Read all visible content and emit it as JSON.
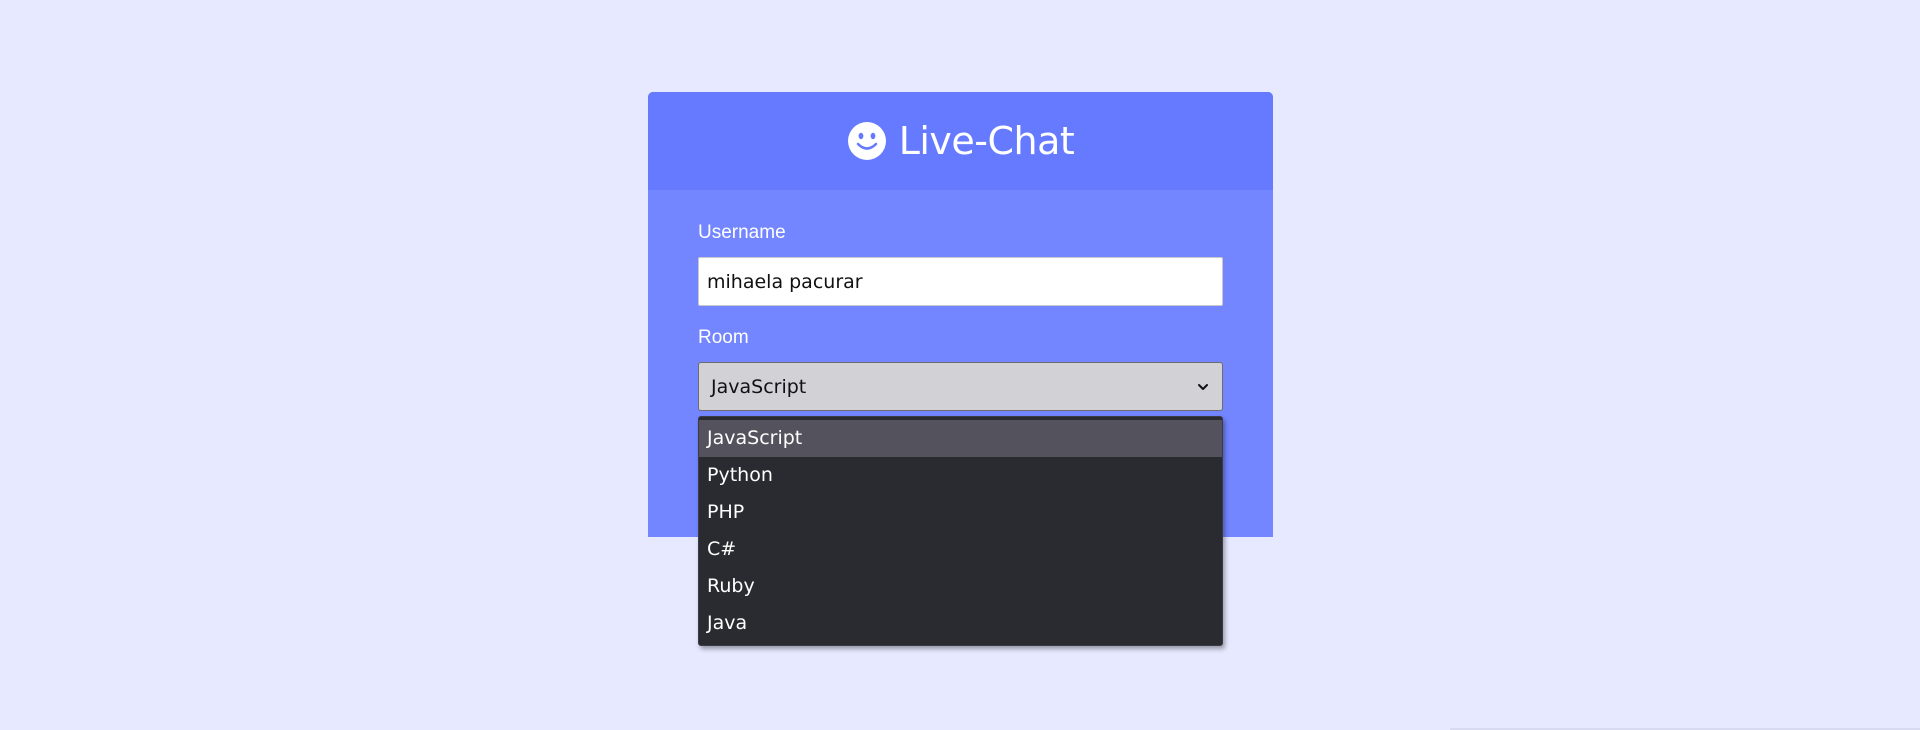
{
  "header": {
    "title": "Live-Chat",
    "icon": "smiley-icon"
  },
  "form": {
    "username_label": "Username",
    "username_value": "mihaela pacurar",
    "room_label": "Room",
    "room_selected": "JavaScript"
  },
  "dropdown": {
    "options": [
      {
        "label": "JavaScript",
        "selected": true
      },
      {
        "label": "Python",
        "selected": false
      },
      {
        "label": "PHP",
        "selected": false
      },
      {
        "label": "C#",
        "selected": false
      },
      {
        "label": "Ruby",
        "selected": false
      },
      {
        "label": "Java",
        "selected": false
      }
    ]
  },
  "colors": {
    "background": "#e6e9ff",
    "header": "#667aff",
    "card": "#7386ff",
    "dropdown": "#2a2a31",
    "dropdown_highlight": "#53525d"
  }
}
